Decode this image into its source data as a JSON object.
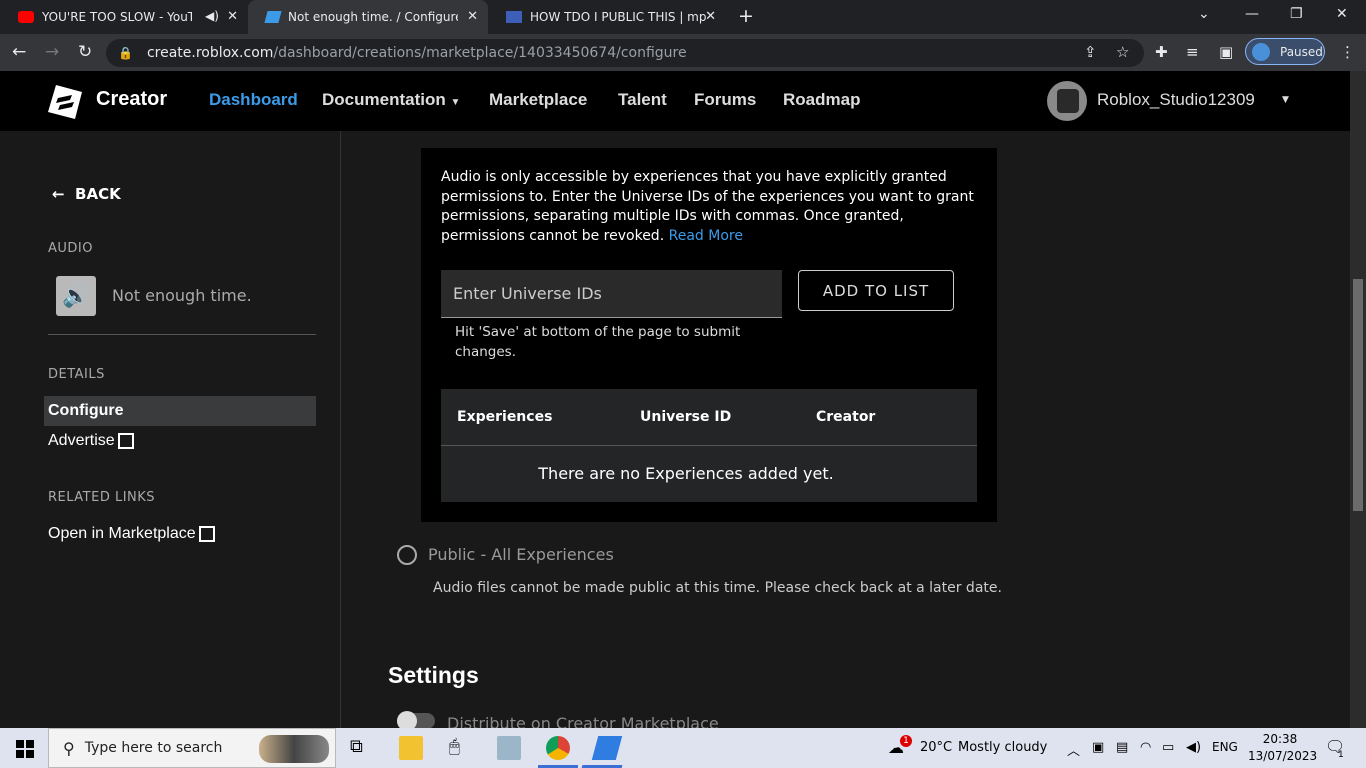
{
  "browser": {
    "tabs": [
      {
        "title": "YOU'RE TOO SLOW - YouTub",
        "active": false
      },
      {
        "title": "Not enough time. / Configure",
        "active": true
      },
      {
        "title": "HOW TDO I PUBLIC THIS | mpp.c",
        "active": false
      }
    ],
    "url_host": "create.roblox.com",
    "url_path": "/dashboard/creations/marketplace/14033450674/configure",
    "profile_status": "Paused"
  },
  "header": {
    "brand": "Creator",
    "nav": [
      "Dashboard",
      "Documentation",
      "Marketplace",
      "Talent",
      "Forums",
      "Roadmap"
    ],
    "active_nav": "Dashboard",
    "username": "Roblox_Studio12309"
  },
  "sidebar": {
    "back_label": "BACK",
    "audio_heading": "AUDIO",
    "asset_name": "Not enough time.",
    "details_heading": "DETAILS",
    "items": [
      {
        "label": "Configure",
        "selected": true
      },
      {
        "label": "Advertise",
        "external": true
      }
    ],
    "related_heading": "RELATED LINKS",
    "related_items": [
      {
        "label": "Open in Marketplace",
        "external": true
      }
    ]
  },
  "permissions": {
    "intro": "Audio is only accessible by experiences that you have explicitly granted permissions to. Enter the Universe IDs of the experiences you want to grant permissions, separating multiple IDs with commas. Once granted, permissions cannot be revoked.",
    "read_more": "Read More",
    "input_placeholder": "Enter Universe IDs",
    "add_button": "ADD TO LIST",
    "hint": "Hit 'Save' at bottom of the page to submit changes.",
    "table_headers": [
      "Experiences",
      "Universe ID",
      "Creator"
    ],
    "empty_text": "There are no Experiences added yet."
  },
  "public_option": {
    "label": "Public - All Experiences",
    "description": "Audio files cannot be made public at this time. Please check back at a later date."
  },
  "settings": {
    "heading": "Settings",
    "distribute_label": "Distribute on Creator Marketplace"
  },
  "taskbar": {
    "search_placeholder": "Type here to search",
    "weather_temp": "20°C",
    "weather_desc": "Mostly cloudy",
    "weather_badge": "1",
    "language": "ENG",
    "time": "20:38",
    "date": "13/07/2023",
    "notification_count": "1"
  },
  "colors": {
    "accent": "#3c9be8",
    "page_bg": "#191919",
    "header_bg": "#000000",
    "selected_bg": "#393b3d"
  }
}
